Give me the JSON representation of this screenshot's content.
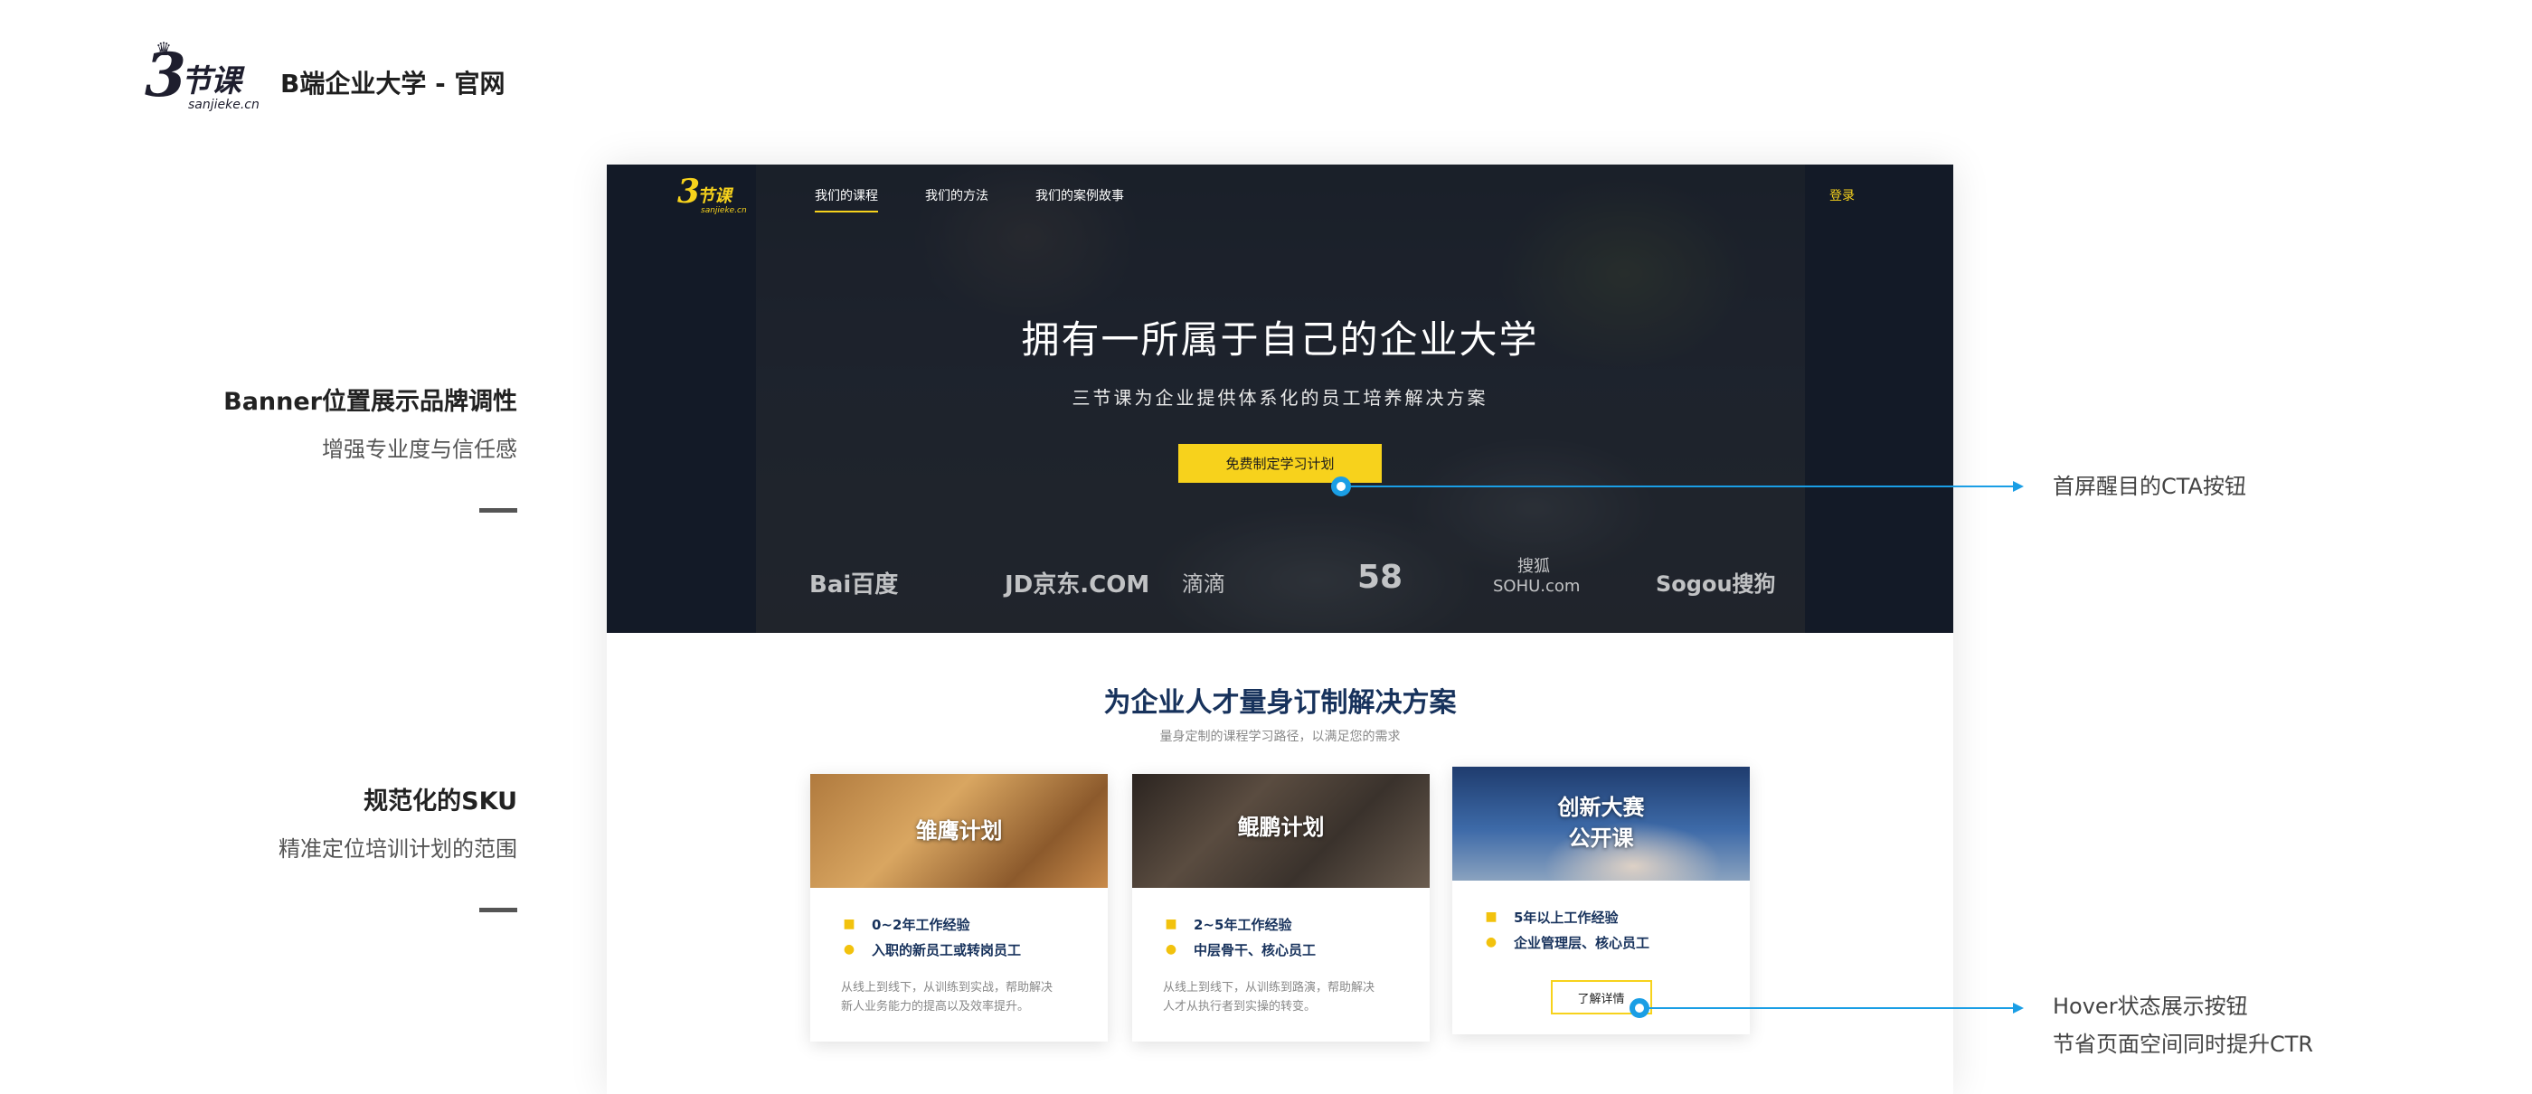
{
  "brand": {
    "logo_glyph": "3",
    "logo_text": "节课",
    "logo_domain": "sanjieke.cn",
    "title": "B端企业大学 - 官网"
  },
  "annotations": {
    "banner": {
      "heading": "Banner位置展示品牌调性",
      "sub": "增强专业度与信任感"
    },
    "sku": {
      "heading": "规范化的SKU",
      "sub": "精准定位培训计划的范围"
    },
    "cta": {
      "text": "首屏醒目的CTA按钮"
    },
    "hover": {
      "line1": "Hover状态展示按钮",
      "line2": "节省页面空间同时提升CTR"
    }
  },
  "site": {
    "nav": {
      "logo_glyph": "3",
      "logo_text": "节课",
      "logo_domain": "sanjieke.cn",
      "links": [
        "我们的课程",
        "我们的方法",
        "我们的案例故事"
      ],
      "active_index": 0,
      "login": "登录"
    },
    "hero": {
      "title": "拥有一所属于自己的企业大学",
      "subtitle": "三节课为企业提供体系化的员工培养解决方案",
      "cta": "免费制定学习计划"
    },
    "client_logos": [
      "Bai百度",
      "JD京东.COM",
      "滴滴",
      "58",
      "搜狐 SOHU.com",
      "Sogou搜狗"
    ],
    "solutions": {
      "title": "为企业人才量身订制解决方案",
      "subtitle": "量身定制的课程学习路径，以满足您的需求",
      "cards": [
        {
          "title_lines": [
            "雏鹰计划"
          ],
          "experience": "0~2年工作经验",
          "audience": "入职的新员工或转岗员工",
          "desc_lines": [
            "从线上到线下，从训练到实战，帮助解决",
            "新人业务能力的提高以及效率提升。"
          ]
        },
        {
          "title_lines": [
            "鲲鹏计划"
          ],
          "experience": "2~5年工作经验",
          "audience": "中层骨干、核心员工",
          "desc_lines": [
            "从线上到线下，从训练到路演，帮助解决",
            "人才从执行者到实操的转变。"
          ]
        },
        {
          "title_lines": [
            "创新大赛",
            "公开课"
          ],
          "experience": "5年以上工作经验",
          "audience": "企业管理层、核心员工",
          "button": "了解详情"
        }
      ]
    }
  },
  "icons": {
    "experience": "briefcase-icon",
    "audience": "people-icon"
  },
  "colors": {
    "accent_yellow": "#f7d21c",
    "callout_blue": "#1a9ee5",
    "navy_text": "#17325c",
    "hero_bg": "#141c28"
  }
}
